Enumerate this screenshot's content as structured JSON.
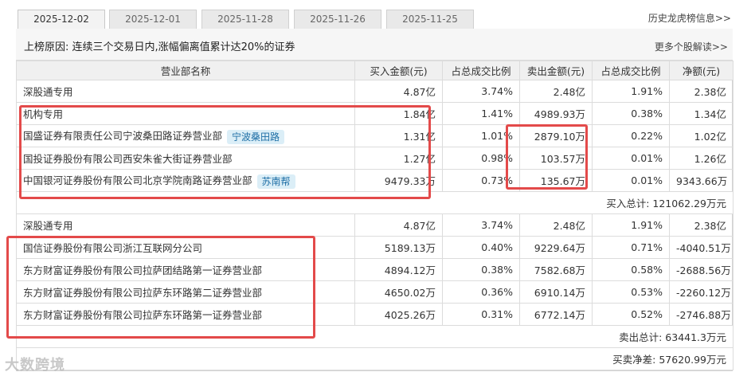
{
  "tabs": [
    {
      "label": "2025-12-02",
      "active": true
    },
    {
      "label": "2025-12-01",
      "active": false
    },
    {
      "label": "2025-11-28",
      "active": false
    },
    {
      "label": "2025-11-26",
      "active": false
    },
    {
      "label": "2025-11-25",
      "active": false
    }
  ],
  "history_link": "历史龙虎榜信息>>",
  "reason": "上榜原因:  连续三个交易日内,涨幅偏离值累计达20%的证券",
  "more_link": "更多个股解读>>",
  "headers": [
    "营业部名称",
    "买入金额(元)",
    "占总成交比例",
    "卖出金额(元)",
    "占总成交比例",
    "净额(元)"
  ],
  "buy_rows": [
    {
      "name": "深股通专用",
      "badge": "",
      "buy": "4.87亿",
      "buy_pct": "3.74%",
      "sell": "2.48亿",
      "sell_pct": "1.91%",
      "net": "2.38亿"
    },
    {
      "name": "机构专用",
      "badge": "",
      "buy": "1.84亿",
      "buy_pct": "1.41%",
      "sell": "4989.93万",
      "sell_pct": "0.38%",
      "net": "1.34亿"
    },
    {
      "name": "国盛证券有限责任公司宁波桑田路证券营业部",
      "badge": "宁波桑田路",
      "buy": "1.31亿",
      "buy_pct": "1.01%",
      "sell": "2879.10万",
      "sell_pct": "0.22%",
      "net": "1.02亿"
    },
    {
      "name": "国投证券股份有限公司西安朱雀大街证券营业部",
      "badge": "",
      "buy": "1.27亿",
      "buy_pct": "0.98%",
      "sell": "103.57万",
      "sell_pct": "0.01%",
      "net": "1.26亿"
    },
    {
      "name": "中国银河证券股份有限公司北京学院南路证券营业部",
      "badge": "苏南帮",
      "buy": "9479.33万",
      "buy_pct": "0.73%",
      "sell": "135.67万",
      "sell_pct": "0.01%",
      "net": "9343.66万"
    }
  ],
  "buy_total": "买入总计: 121062.29万元",
  "sell_rows": [
    {
      "name": "深股通专用",
      "badge": "",
      "buy": "4.87亿",
      "buy_pct": "3.74%",
      "sell": "2.48亿",
      "sell_pct": "1.91%",
      "net": "2.38亿"
    },
    {
      "name": "国信证券股份有限公司浙江互联网分公司",
      "badge": "",
      "buy": "5189.13万",
      "buy_pct": "0.40%",
      "sell": "9229.64万",
      "sell_pct": "0.71%",
      "net": "-4040.51万"
    },
    {
      "name": "东方财富证券股份有限公司拉萨团结路第一证券营业部",
      "badge": "",
      "buy": "4894.12万",
      "buy_pct": "0.38%",
      "sell": "7582.68万",
      "sell_pct": "0.58%",
      "net": "-2688.56万"
    },
    {
      "name": "东方财富证券股份有限公司拉萨东环路第二证券营业部",
      "badge": "",
      "buy": "4650.02万",
      "buy_pct": "0.36%",
      "sell": "6910.14万",
      "sell_pct": "0.53%",
      "net": "-2260.12万"
    },
    {
      "name": "东方财富证券股份有限公司拉萨东环路第一证券营业部",
      "badge": "",
      "buy": "4025.26万",
      "buy_pct": "0.31%",
      "sell": "6772.14万",
      "sell_pct": "0.52%",
      "net": "-2746.88万"
    }
  ],
  "sell_total": "卖出总计: 63441.3万元",
  "net_total": "买卖净差: 57620.99万元",
  "watermark": "大数跨境",
  "colors": {
    "highlight": "#e34a4a",
    "badge_bg": "#dbeef7",
    "badge_text": "#1f6fa6",
    "header_bg": "#f0f0f0"
  }
}
